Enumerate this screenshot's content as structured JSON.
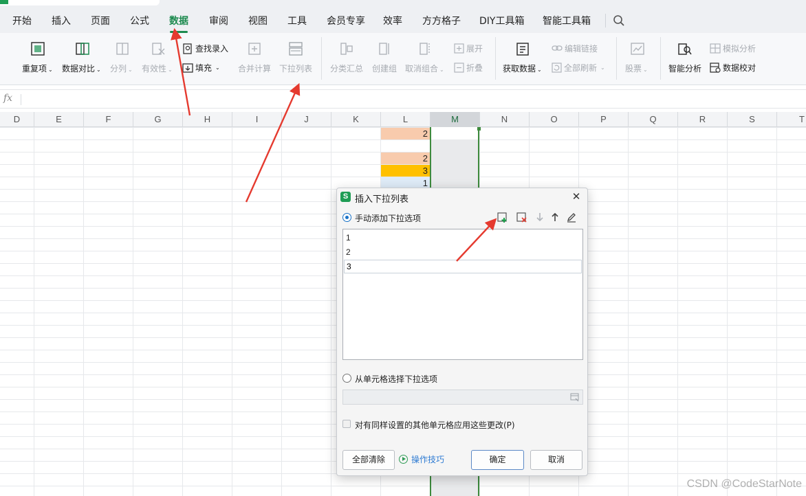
{
  "menu": {
    "tabs": [
      "开始",
      "插入",
      "页面",
      "公式",
      "数据",
      "审阅",
      "视图",
      "工具",
      "会员专享",
      "效率",
      "方方格子",
      "DIY工具箱",
      "智能工具箱"
    ],
    "active": "数据"
  },
  "ribbon": {
    "repeat": "重复项",
    "compare": "数据对比",
    "split": "分列",
    "validity": "有效性",
    "find_entry": "查找录入",
    "fill": "填充",
    "merge_calc": "合并计算",
    "dropdown_list": "下拉列表",
    "subtotal": "分类汇总",
    "create_group": "创建组",
    "ungroup": "取消组合",
    "expand": "展开",
    "collapse": "折叠",
    "get_data": "获取数据",
    "edit_links": "编辑链接",
    "refresh_all": "全部刷新",
    "stocks": "股票",
    "simulation": "模拟分析",
    "smart_analysis": "智能分析",
    "data_check": "数据校对"
  },
  "formula_bar": {
    "fx": "fx"
  },
  "columns": [
    "D",
    "E",
    "F",
    "G",
    "H",
    "I",
    "J",
    "K",
    "L",
    "M",
    "N",
    "O",
    "P",
    "Q",
    "R",
    "S",
    "T"
  ],
  "selected_column": "M",
  "cells_L": [
    {
      "row": 0,
      "value": "2",
      "color": "#f8cbad"
    },
    {
      "row": 1,
      "value": "",
      "color": "#ffffff"
    },
    {
      "row": 2,
      "value": "2",
      "color": "#f8cbad"
    },
    {
      "row": 3,
      "value": "3",
      "color": "#ffc000"
    },
    {
      "row": 4,
      "value": "1",
      "color": "#deebf7"
    }
  ],
  "dialog": {
    "logo": "S",
    "title": "插入下拉列表",
    "manual_option": "手动添加下拉选项",
    "items": [
      "1",
      "2"
    ],
    "editing_value": "3",
    "cell_option": "从单元格选择下拉选项",
    "apply_same": "对有同样设置的其他单元格应用这些更改(P)",
    "clear_all": "全部清除",
    "tips": "操作技巧",
    "ok": "确定",
    "cancel": "取消"
  },
  "watermark": "CSDN @CodeStarNote",
  "colors": {
    "accent_green": "#1d8a4f",
    "arrow_red": "#e53a2f",
    "selection_green": "#3d8a3d"
  }
}
